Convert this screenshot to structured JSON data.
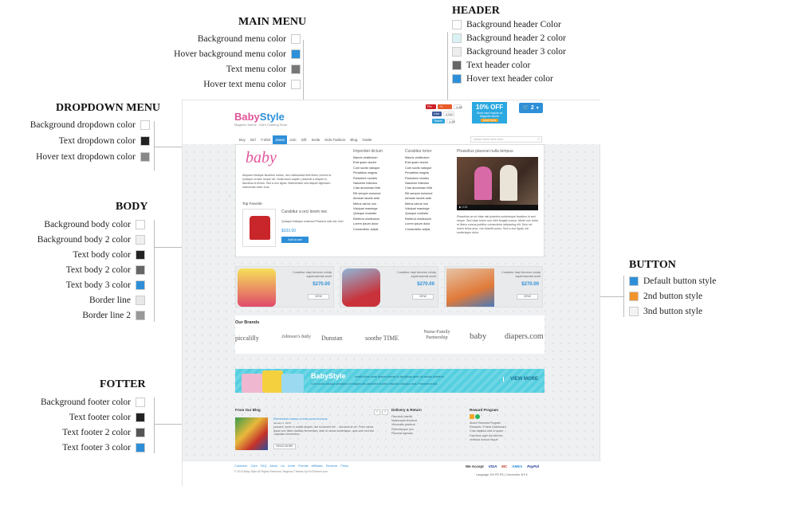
{
  "annotations": {
    "main_menu": {
      "title": "MAIN MENU",
      "rows": [
        {
          "label": "Background menu color",
          "color": "#ffffff"
        },
        {
          "label": "Hover background menu color",
          "color": "#2e8fd8"
        },
        {
          "label": "Text menu color",
          "color": "#777777"
        },
        {
          "label": "Hover text menu color",
          "color": "#ffffff"
        }
      ]
    },
    "header": {
      "title": "HEADER",
      "rows": [
        {
          "label": "Background header Color",
          "color": "#ffffff"
        },
        {
          "label": "Background header 2 color",
          "color": "#d9f1f3"
        },
        {
          "label": "Background header 3 color",
          "color": "#ededed"
        },
        {
          "label": "Text header color",
          "color": "#666666"
        },
        {
          "label": "Hover text header color",
          "color": "#2e8fd8"
        }
      ]
    },
    "dropdown": {
      "title": "DROPDOWN MENU",
      "rows": [
        {
          "label": "Background dropdown color",
          "color": "#ffffff"
        },
        {
          "label": "Text dropdown color",
          "color": "#222222"
        },
        {
          "label": "Hover text dropdown color",
          "color": "#888888"
        }
      ]
    },
    "body": {
      "title": "BODY",
      "rows": [
        {
          "label": "Background body color",
          "color": "#ffffff"
        },
        {
          "label": "Background body 2 color",
          "color": "#f0f0f0"
        },
        {
          "label": "Text body color",
          "color": "#222222"
        },
        {
          "label": "Text body 2 color",
          "color": "#666666"
        },
        {
          "label": "Text body 3 color",
          "color": "#2e8fd8"
        },
        {
          "label": "Border line",
          "color": "#e8e8e8"
        },
        {
          "label": "Border line 2",
          "color": "#999999"
        }
      ]
    },
    "button": {
      "title": "BUTTON",
      "rows": [
        {
          "label": "Default button style",
          "color": "#2e8fd8"
        },
        {
          "label": "2nd button style",
          "color": "#f0952b"
        },
        {
          "label": "3nd button style",
          "color": "#f3f3f3"
        }
      ]
    },
    "footer": {
      "title": "FOTTER",
      "rows": [
        {
          "label": "Background footer color",
          "color": "#ffffff"
        },
        {
          "label": "Text footer color",
          "color": "#222222"
        },
        {
          "label": "Text footer 2 color",
          "color": "#555555"
        },
        {
          "label": "Text footer 3 color",
          "color": "#2e8fd8"
        }
      ]
    }
  },
  "site": {
    "logo_a": "Baby",
    "logo_b": "Style",
    "logo_sub": "Magento theme - Kid's Clothing Store",
    "promo": {
      "big": "10% OFF",
      "small": "Store card require at Magento stores",
      "btn": "SHOP NOW"
    },
    "cart_count": "2",
    "menu": [
      "Boy",
      "Girl",
      "T-shirt",
      "Jeans",
      "Join",
      "Gift",
      "Invite",
      "Kids Fashion",
      "Blog",
      "Outlet"
    ],
    "search_placeholder": "search entire store here...",
    "dropdown": {
      "intro": "Aliquam tristique faucibus metus, nec malesuada felis libero viverra id. Quisque ornare neque vel. Nulla lacus sapien, placerat a aliquet in, faucibus ut lectus. Sed a orci ligula. Maecenatur ulla aliquet dignissim maecenas dolor eros.",
      "fav_title": "Top Favorite",
      "fav_name": "Curabitur a orci lorem nec",
      "fav_desc": "Quisque tristique euismod Phasent odio est, tred",
      "fav_price": "$332.00",
      "fav_btn": "Add to cart",
      "col1_title": "Imperdiet dictum",
      "col1": [
        "Mauris vestibulum",
        "Erat quam auctor",
        "Cum sociis natoque",
        "Penatibus magnis",
        "Parturient montes",
        "Nascetur ridiculus",
        "Cras accumsan felis",
        "Elit semper euismod",
        "Aenean iaculis ante",
        "Metus varius non",
        "Volutpat mauriege",
        "Quisque molestie",
        "Eleifend vestibulum",
        "Lorem ipsum dolor",
        "Consectetur adipis"
      ],
      "col2_title": "Curabitur tortor",
      "col2": [
        "Mauris vestibulum",
        "Erat quam auctor",
        "Cum sociis natoque",
        "Penatibus magnis",
        "Parturient montes",
        "Nascetur ridiculus",
        "Cras accumsan felis",
        "Elit semper euismod",
        "Aenean iaculis ante",
        "Metus varius non",
        "Volutpat mauriege",
        "Quisque molestie",
        "Eleifend vestibulum",
        "Lorem ipsum dolor",
        "Consectetur adipis"
      ],
      "col3_title": "Phasellus placerat nulla tempus",
      "video_time": "0:24",
      "video_txt": "Phasellus ac mi vitae nisi pharetra scelerisque faucibus in sed neque. Sed vitae lorem non nibh feugiat cursus. Morbi nec tortor et libero cursus porttitor consectetur adipiscing elit. Duis vel lorem tellus arcu, non blandit purus. Sed a orci ligula, vel scelerisque dolor."
    },
    "products": [
      {
        "name": "Curabitur dapi Aenean volutp sapienssmsit amet",
        "price": "$270.00",
        "btn": "VIEW"
      },
      {
        "name": "Curabitur dapi Aenean volutp sapienssmsit amet",
        "price": "$270.00",
        "btn": "VIEW"
      },
      {
        "name": "Curabitur dapi Aenean volutp sapienssmsit amet",
        "price": "$270.00",
        "btn": "VIEW"
      }
    ],
    "brands_title": "Our Brands",
    "brands": [
      "piccalilly",
      "Johnson's baby",
      "Dunstan",
      "soothe TIME",
      "Nurse-Family Partnership",
      "baby",
      "diapers.com"
    ],
    "banner": {
      "title": "BabyStyle",
      "line1": "vestibulum ante ipsum primis in faucibus ante ut varius sceleris",
      "line2": "Cum sociis natoque penatibus et magnis dis parturient montes nascetur ridiculus mus. Praesent mollis",
      "more": "VIEW MORE"
    },
    "footer_cols": {
      "blog_title": "From Our Blog",
      "blog_post_title": "Elementum massa ut erat porta rhoncus",
      "blog_post_date": "January 1, 2015",
      "blog_post_txt": "posuere, lorem in mattis aliquet, nisl mi laoreet feli ... tincidunt at vel. Proin varius ipsum nec libero facilisis fermentum, ante ut varius scelerisque, quis sem sed nisi vulputate elementum.",
      "read_more": "READ MORE",
      "delivery_title": "Delivery & Return",
      "delivery": [
        "Faucibus blandit",
        "Malesuada tincidunt",
        "Venenatis placerat",
        "Pellentesque non",
        "Placerat egestas"
      ],
      "reward_title": "Reward Program",
      "reward": [
        "About Rewards Program",
        "Rewards / Points Dashboard",
        "Cras dapibus erat ut quam",
        "Faucibus eget dui ultricies",
        "vehicula cursus risque"
      ]
    },
    "footer": {
      "links": "Customer Care   FAQ   About Us   Invite Friends   Affiliates   Reviews   Press",
      "copyright": "© 2013 Baby Style All Rights Reserved. Magento Themes by EmThemes.com",
      "we_accept": "We Accept",
      "cards": [
        "VISA",
        "MC",
        "AMEX",
        "PayPal"
      ],
      "lang": "Language: EN  FR  ES   |   Currencies: $  €  £"
    }
  }
}
